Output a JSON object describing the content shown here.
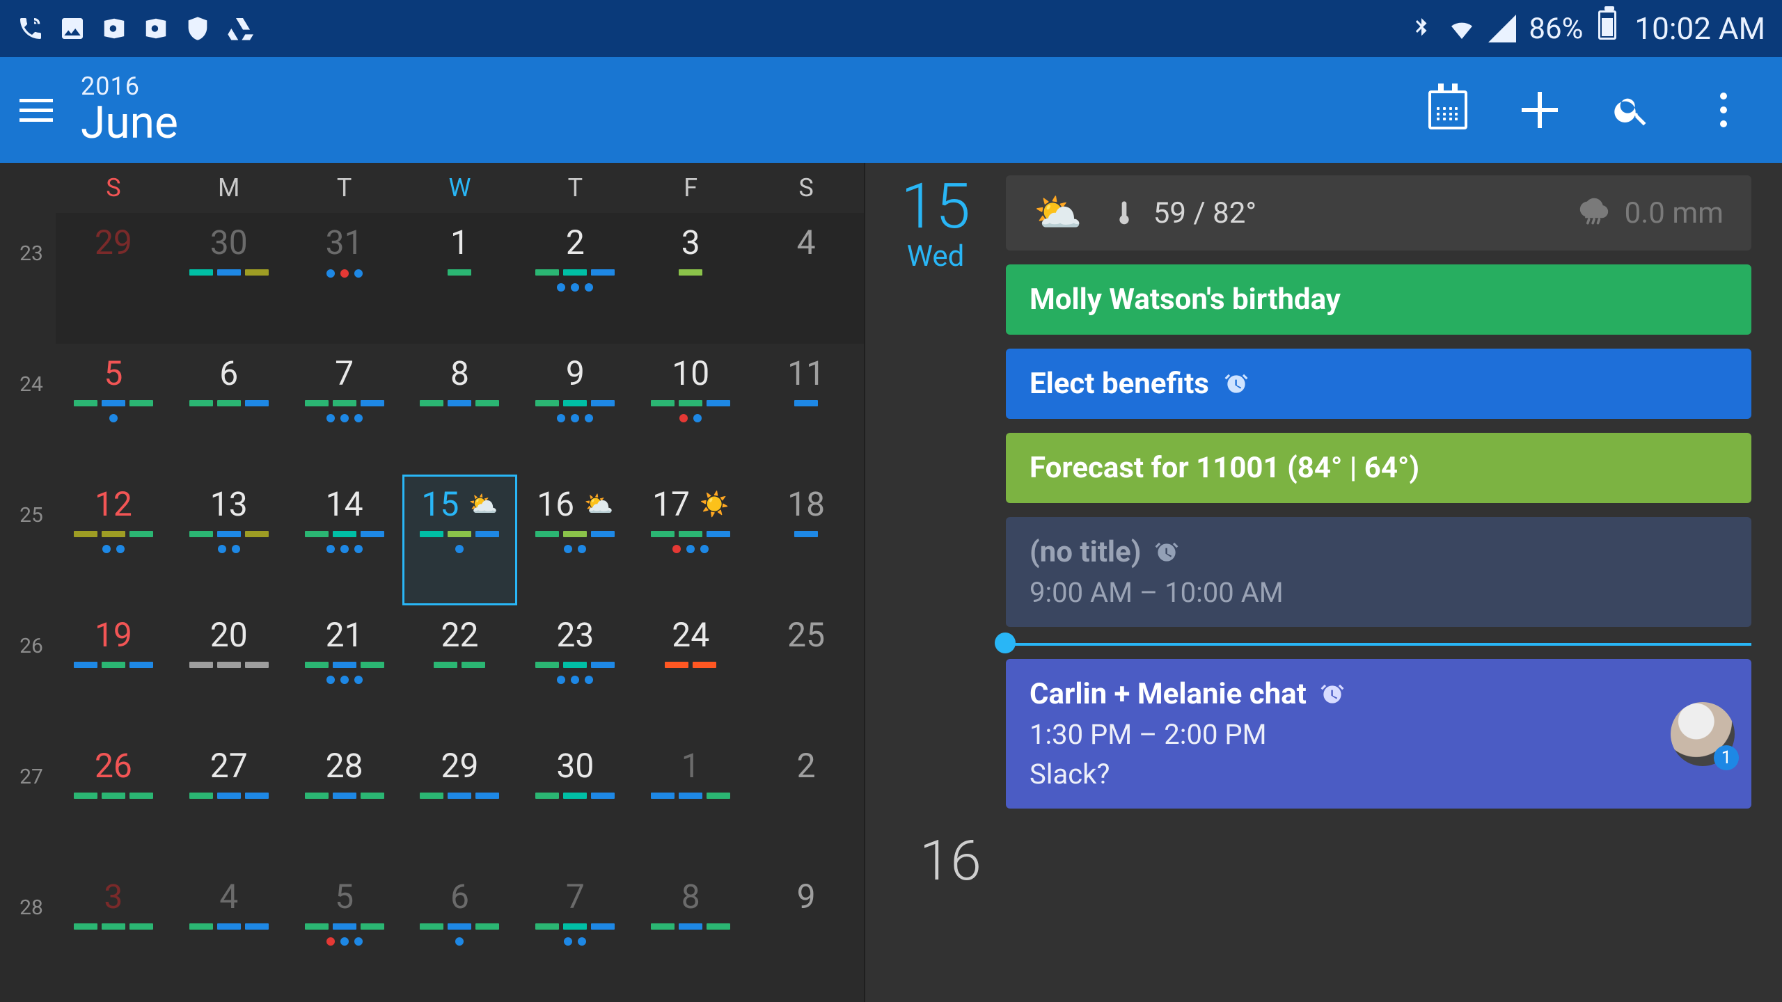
{
  "statusbar": {
    "battery_pct": "86%",
    "clock": "10:02 AM"
  },
  "appbar": {
    "year": "2016",
    "month": "June"
  },
  "calendar": {
    "dow": [
      "S",
      "M",
      "T",
      "W",
      "T",
      "F",
      "S"
    ],
    "today_dow_index": 3,
    "weeks": [
      {
        "wk": "23",
        "dim": true,
        "days": [
          {
            "n": "29",
            "sun": true,
            "prev": true,
            "bars": [],
            "dots": []
          },
          {
            "n": "30",
            "prev": true,
            "bars": [
              "teal",
              "blue",
              "olive"
            ],
            "dots": []
          },
          {
            "n": "31",
            "prev": true,
            "bars": [],
            "dots": [
              "blue",
              "red",
              "blue"
            ]
          },
          {
            "n": "1",
            "bars": [
              "green"
            ],
            "dots": []
          },
          {
            "n": "2",
            "bars": [
              "green",
              "teal",
              "blue"
            ],
            "dots": [
              "blue",
              "blue",
              "blue"
            ]
          },
          {
            "n": "3",
            "bars": [
              "lime"
            ],
            "dots": []
          },
          {
            "n": "4",
            "sat": true,
            "bars": [],
            "dots": []
          }
        ]
      },
      {
        "wk": "24",
        "days": [
          {
            "n": "5",
            "sun": true,
            "bars": [
              "green",
              "blue",
              "green"
            ],
            "dots": [
              "blue"
            ]
          },
          {
            "n": "6",
            "bars": [
              "green",
              "green",
              "blue"
            ],
            "dots": []
          },
          {
            "n": "7",
            "bars": [
              "green",
              "green",
              "blue"
            ],
            "dots": [
              "blue",
              "blue",
              "blue"
            ]
          },
          {
            "n": "8",
            "bars": [
              "green",
              "blue",
              "green"
            ],
            "dots": []
          },
          {
            "n": "9",
            "bars": [
              "green",
              "teal",
              "blue"
            ],
            "dots": [
              "blue",
              "blue",
              "blue"
            ]
          },
          {
            "n": "10",
            "bars": [
              "green",
              "green",
              "blue"
            ],
            "dots": [
              "red",
              "blue"
            ]
          },
          {
            "n": "11",
            "sat": true,
            "bars": [
              "blue"
            ],
            "dots": []
          }
        ]
      },
      {
        "wk": "25",
        "days": [
          {
            "n": "12",
            "sun": true,
            "bars": [
              "olive",
              "olive",
              "green"
            ],
            "dots": [
              "blue",
              "blue"
            ]
          },
          {
            "n": "13",
            "bars": [
              "green",
              "blue",
              "olive"
            ],
            "dots": [
              "blue",
              "blue"
            ]
          },
          {
            "n": "14",
            "bars": [
              "green",
              "teal",
              "blue"
            ],
            "dots": [
              "blue",
              "blue",
              "blue"
            ]
          },
          {
            "n": "15",
            "today": true,
            "wx": "⛅",
            "bars": [
              "teal",
              "lime",
              "blue"
            ],
            "dots": [
              "blue"
            ]
          },
          {
            "n": "16",
            "wx": "⛅",
            "bars": [
              "green",
              "lime",
              "blue"
            ],
            "dots": [
              "blue",
              "blue"
            ]
          },
          {
            "n": "17",
            "wx": "☀️",
            "bars": [
              "green",
              "green",
              "blue"
            ],
            "dots": [
              "red",
              "blue",
              "blue"
            ]
          },
          {
            "n": "18",
            "sat": true,
            "bars": [
              "blue"
            ],
            "dots": []
          }
        ]
      },
      {
        "wk": "26",
        "days": [
          {
            "n": "19",
            "sun": true,
            "bars": [
              "blue",
              "green",
              "blue"
            ],
            "dots": []
          },
          {
            "n": "20",
            "bars": [
              "grey",
              "grey",
              "grey"
            ],
            "dots": []
          },
          {
            "n": "21",
            "bars": [
              "green",
              "blue",
              "green"
            ],
            "dots": [
              "blue",
              "blue",
              "blue"
            ]
          },
          {
            "n": "22",
            "bars": [
              "green",
              "green"
            ],
            "dots": []
          },
          {
            "n": "23",
            "bars": [
              "green",
              "teal",
              "blue"
            ],
            "dots": [
              "blue",
              "blue",
              "blue"
            ]
          },
          {
            "n": "24",
            "bars": [
              "orange",
              "orange"
            ],
            "dots": []
          },
          {
            "n": "25",
            "sat": true,
            "bars": [],
            "dots": []
          }
        ]
      },
      {
        "wk": "27",
        "days": [
          {
            "n": "26",
            "sun": true,
            "bars": [
              "green",
              "green",
              "green"
            ],
            "dots": []
          },
          {
            "n": "27",
            "bars": [
              "green",
              "blue",
              "blue"
            ],
            "dots": []
          },
          {
            "n": "28",
            "bars": [
              "green",
              "blue",
              "green"
            ],
            "dots": []
          },
          {
            "n": "29",
            "bars": [
              "green",
              "blue",
              "blue"
            ],
            "dots": []
          },
          {
            "n": "30",
            "bars": [
              "green",
              "teal",
              "blue"
            ],
            "dots": []
          },
          {
            "n": "1",
            "next": true,
            "bars": [
              "blue",
              "blue",
              "green"
            ],
            "dots": []
          },
          {
            "n": "2",
            "sat": true,
            "next": true,
            "bars": [],
            "dots": []
          }
        ]
      },
      {
        "wk": "28",
        "days": [
          {
            "n": "3",
            "sun": true,
            "next": true,
            "bars": [
              "green",
              "green",
              "green"
            ],
            "dots": []
          },
          {
            "n": "4",
            "next": true,
            "bars": [
              "green",
              "blue",
              "blue"
            ],
            "dots": []
          },
          {
            "n": "5",
            "next": true,
            "bars": [
              "green",
              "blue",
              "green"
            ],
            "dots": [
              "red",
              "blue",
              "blue"
            ]
          },
          {
            "n": "6",
            "next": true,
            "bars": [
              "green",
              "blue",
              "green"
            ],
            "dots": [
              "blue"
            ]
          },
          {
            "n": "7",
            "next": true,
            "bars": [
              "green",
              "teal",
              "blue"
            ],
            "dots": [
              "blue",
              "blue"
            ]
          },
          {
            "n": "8",
            "next": true,
            "bars": [
              "green",
              "blue",
              "green"
            ],
            "dots": []
          },
          {
            "n": "9",
            "sat": true,
            "next": true,
            "bars": [],
            "dots": []
          }
        ]
      }
    ]
  },
  "agenda": {
    "day_num": "15",
    "day_dow": "Wed",
    "weather": {
      "temps": "59 / 82°",
      "precip": "0.0 mm"
    },
    "events": {
      "birthday": {
        "title": "Molly Watson's birthday"
      },
      "benefits": {
        "title": "Elect benefits"
      },
      "forecast": {
        "title": "Forecast for 11001 (84° | 64°)"
      },
      "notitle": {
        "title": "(no title)",
        "time": "9:00 AM – 10:00 AM"
      },
      "chat": {
        "title": "Carlin + Melanie chat",
        "time": "1:30 PM – 2:00 PM",
        "note": "Slack?",
        "badge": "1"
      }
    },
    "next_day_num": "16"
  }
}
